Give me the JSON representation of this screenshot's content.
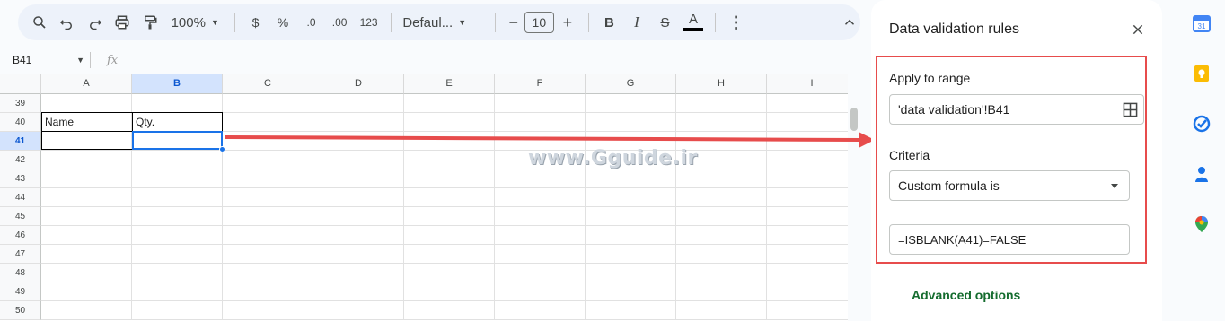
{
  "toolbar": {
    "zoom": "100%",
    "currency": "$",
    "percent": "%",
    "decrease_decimal": ".0",
    "increase_decimal": ".00",
    "number_format": "123",
    "font": "Defaul...",
    "font_size": "10",
    "font_size_minus": "−",
    "font_size_plus": "+",
    "bold": "B",
    "italic": "I",
    "strike": "S",
    "text_color": "A",
    "more": "⋮",
    "collapse": "^"
  },
  "formula_bar": {
    "name_box": "B41",
    "fx": "fx"
  },
  "grid": {
    "columns": [
      "A",
      "B",
      "C",
      "D",
      "E",
      "F",
      "G",
      "H",
      "I"
    ],
    "selected_column": "B",
    "rows": [
      "39",
      "40",
      "41",
      "42",
      "43",
      "44",
      "45",
      "46",
      "47",
      "48",
      "49",
      "50"
    ],
    "selected_row": "41",
    "cells": {
      "A40": "Name",
      "B40": "Qty."
    }
  },
  "watermark": "www.Gguide.ir",
  "panel": {
    "title": "Data validation rules",
    "apply_label": "Apply to range",
    "range_value": "'data validation'!B41",
    "criteria_label": "Criteria",
    "criteria_value": "Custom formula is",
    "formula_value": "=ISBLANK(A41)=FALSE",
    "advanced": "Advanced options"
  },
  "colors": {
    "accent": "#1a73e8",
    "highlight_box": "#e74c4c",
    "advanced_link": "#146c2e"
  },
  "rail_icons": [
    "calendar-icon",
    "keep-icon",
    "tasks-icon",
    "contacts-icon",
    "maps-icon"
  ]
}
